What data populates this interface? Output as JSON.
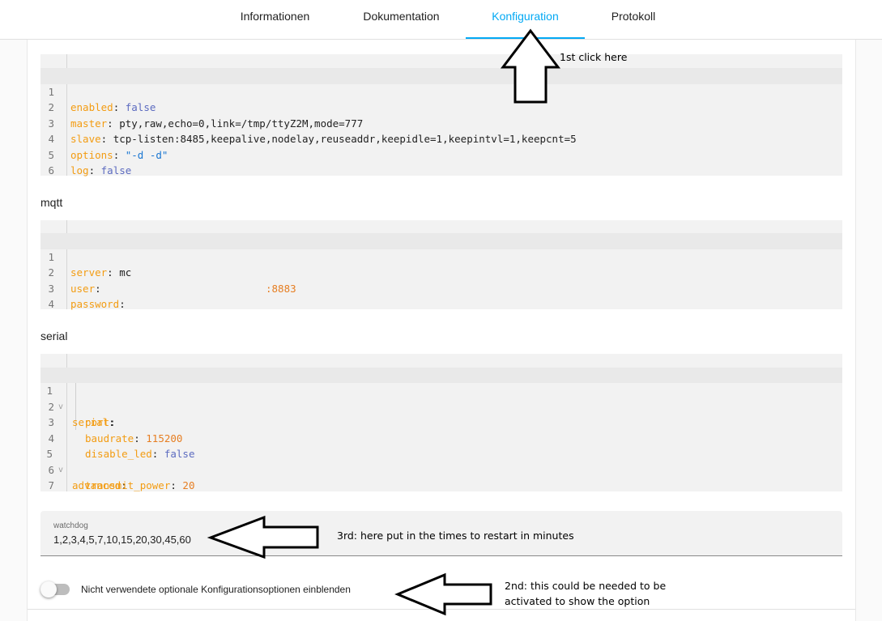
{
  "tabs": [
    {
      "label": "Informationen",
      "active": false
    },
    {
      "label": "Dokumentation",
      "active": false
    },
    {
      "label": "Konfiguration",
      "active": true
    },
    {
      "label": "Protokoll",
      "active": false
    }
  ],
  "editors": {
    "options": {
      "line_numbers": [
        "1",
        "2",
        "3",
        "4",
        "5",
        "6"
      ],
      "lines": [
        {
          "key": "enabled",
          "value": "false"
        },
        {
          "key": "master",
          "value": "pty,raw,echo=0,link=/tmp/ttyZ2M,mode=777"
        },
        {
          "key": "slave",
          "value": "tcp-listen:8485,keepalive,nodelay,reuseaddr,keepidle=1,keepintvl=1,keepcnt=5"
        },
        {
          "key": "options",
          "value": "\"-d -d\""
        },
        {
          "key": "log",
          "value": "false"
        }
      ]
    },
    "mqtt": {
      "section_label": "mqtt",
      "line_numbers": [
        "1",
        "2",
        "3",
        "4"
      ],
      "lines": [
        {
          "key": "server",
          "value": "mc",
          "port": ":8883"
        },
        {
          "key": "user",
          "value": ""
        },
        {
          "key": "password",
          "value": ""
        }
      ]
    },
    "serial": {
      "section_label": "serial",
      "line_numbers": [
        "1",
        "2",
        "3",
        "4",
        "5",
        "6",
        "7"
      ],
      "fold_marker": "v",
      "lines": [
        {
          "key": "serial",
          "value": ""
        },
        {
          "key": "port",
          "value": ""
        },
        {
          "key": "baudrate",
          "value": "115200"
        },
        {
          "key": "disable_led",
          "value": "false"
        },
        {
          "key": "advanced",
          "value": ""
        },
        {
          "key": "transmit_power",
          "value": "20"
        }
      ]
    }
  },
  "watchdog": {
    "label": "watchdog",
    "value": "1,2,3,4,5,7,10,15,20,30,45,60"
  },
  "toggle": {
    "label": "Nicht verwendete optionale Konfigurationsoptionen einblenden",
    "checked": false
  },
  "annotations": {
    "first": "1st click here",
    "second_line1": "2nd: this could be needed to be",
    "second_line2": "activated to show the option",
    "third": "3rd: here put in the times to restart in minutes"
  },
  "colors": {
    "accent": "#03a9f4",
    "yaml_key": "#f39c12",
    "yaml_bool": "#5c6bc0",
    "yaml_string": "#1976d2",
    "yaml_number": "#e67e22"
  }
}
